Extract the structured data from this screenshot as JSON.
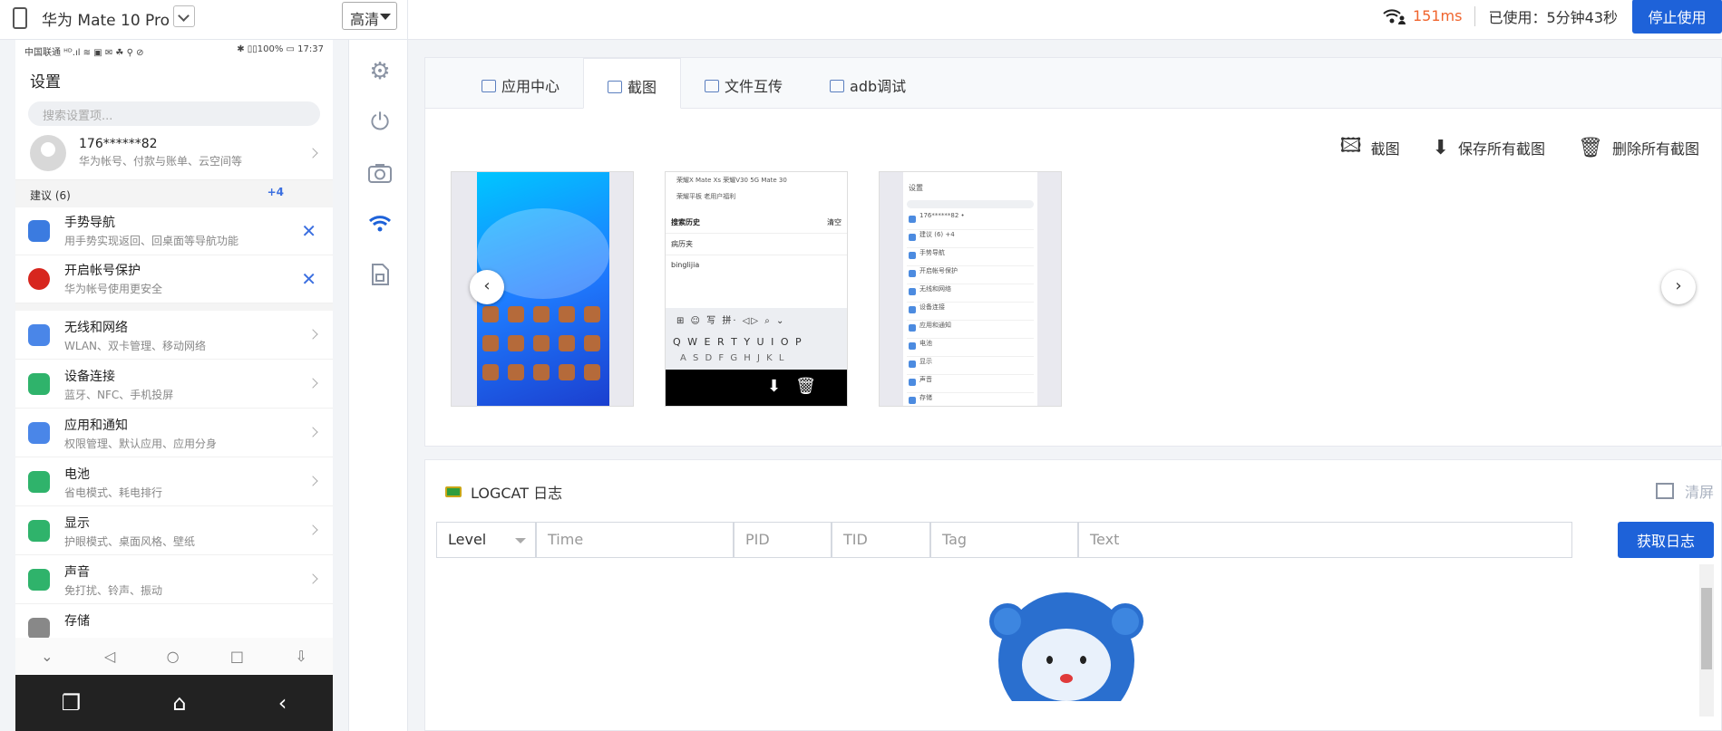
{
  "topbar": {
    "device_name": "华为 Mate 10 Pro",
    "quality": "高清",
    "ping": "151ms",
    "usage": "已使用：5分钟43秒",
    "stop_button": "停止使用"
  },
  "phone": {
    "status_left": "中国联通 ᴴᴰ.ıl ≋ ▣ ✉ ☘ ⚲ ⊘",
    "status_right": "✱ ▯▯100% ▭ 17:37",
    "title": "设置",
    "search_placeholder": "搜索设置项...",
    "account": {
      "name": "176******82",
      "desc": "华为帐号、付款与账单、云空间等"
    },
    "suggestions_header": "建议 (6)",
    "suggestions_more": "+4",
    "suggestions": [
      {
        "title": "手势导航",
        "desc": "用手势实现返回、回桌面等导航功能",
        "color": "#3b7be0"
      },
      {
        "title": "开启帐号保护",
        "desc": "华为帐号使用更安全",
        "color": "#d7261e"
      }
    ],
    "rows": [
      {
        "title": "无线和网络",
        "desc": "WLAN、双卡管理、移动网络",
        "color": "#4a86e8"
      },
      {
        "title": "设备连接",
        "desc": "蓝牙、NFC、手机投屏",
        "color": "#2fb36b"
      },
      {
        "title": "应用和通知",
        "desc": "权限管理、默认应用、应用分身",
        "color": "#4a86e8"
      },
      {
        "title": "电池",
        "desc": "省电模式、耗电排行",
        "color": "#2fb36b"
      },
      {
        "title": "显示",
        "desc": "护眼模式、桌面风格、壁纸",
        "color": "#2fb36b"
      },
      {
        "title": "声音",
        "desc": "免打扰、铃声、振动",
        "color": "#2fb36b"
      },
      {
        "title": "存储",
        "desc": "",
        "color": "#888888"
      }
    ]
  },
  "tabs": [
    {
      "label": "应用中心"
    },
    {
      "label": "截图"
    },
    {
      "label": "文件互传"
    },
    {
      "label": "adb调试"
    }
  ],
  "screenshot_actions": {
    "capture": "截图",
    "save_all": "保存所有截图",
    "delete_all": "删除所有截图"
  },
  "screenshot2": {
    "row_top": "荣耀X  Mate Xs  荣耀V30 5G  Mate 30",
    "row_top2": "荣耀平板  老用户福利",
    "history_title": "搜索历史",
    "history_clear": "清空",
    "history_1": "病历夹",
    "history_2": "binglijia",
    "kb_toolbar": "⊞  ☺  写  拼·  ◁▷  ⌕  ⌄",
    "kb_row1": "Q W E R T Y U I O P",
    "kb_row2": "A S D F G H J K L"
  },
  "screenshot3": {
    "title": "设置",
    "items": [
      "176******82 •",
      "建议 (6)  +4",
      "手势导航",
      "开启帐号保护",
      "无线和网络",
      "设备连接",
      "应用和通知",
      "电池",
      "显示",
      "声音",
      "存储"
    ]
  },
  "log": {
    "title": "LOGCAT 日志",
    "clear": "清屏",
    "level": "Level",
    "time_placeholder": "Time",
    "pid_placeholder": "PID",
    "tid_placeholder": "TID",
    "tag_placeholder": "Tag",
    "text_placeholder": "Text",
    "get_button": "获取日志"
  }
}
